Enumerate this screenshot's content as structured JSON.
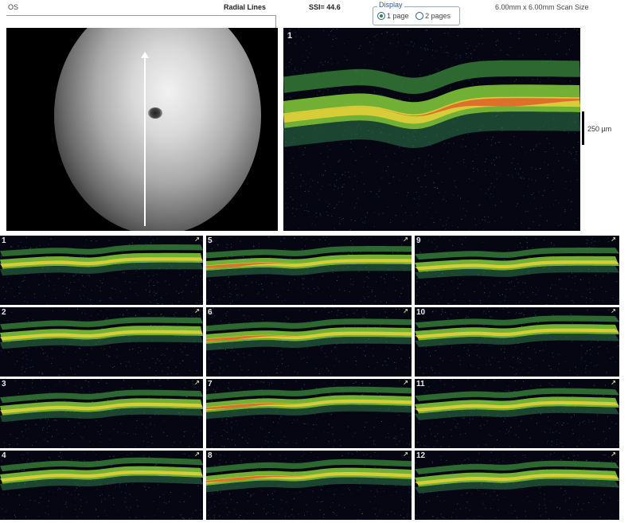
{
  "header": {
    "eye": "OS",
    "scan_type": "Radial Lines",
    "ssi": "SSI= 44.6",
    "scan_size": "6.00mm x 6.00mm Scan Size"
  },
  "display": {
    "legend": "Display",
    "options": [
      {
        "label": "1 page",
        "selected": true
      },
      {
        "label": "2 pages",
        "selected": false
      }
    ]
  },
  "main_scan": {
    "number": "1"
  },
  "scale": {
    "label": "250 µm"
  },
  "thumbnails": [
    {
      "number": "1"
    },
    {
      "number": "2"
    },
    {
      "number": "3"
    },
    {
      "number": "4"
    },
    {
      "number": "5"
    },
    {
      "number": "6"
    },
    {
      "number": "7"
    },
    {
      "number": "8"
    },
    {
      "number": "9"
    },
    {
      "number": "10"
    },
    {
      "number": "11"
    },
    {
      "number": "12"
    }
  ],
  "colors": {
    "retina_green": "#7ec33a",
    "rpe_yellow": "#e8d23a",
    "hot_red": "#e0502a",
    "noise_blue": "#2a4aa0",
    "radio_fill": "#2a8a2a"
  }
}
